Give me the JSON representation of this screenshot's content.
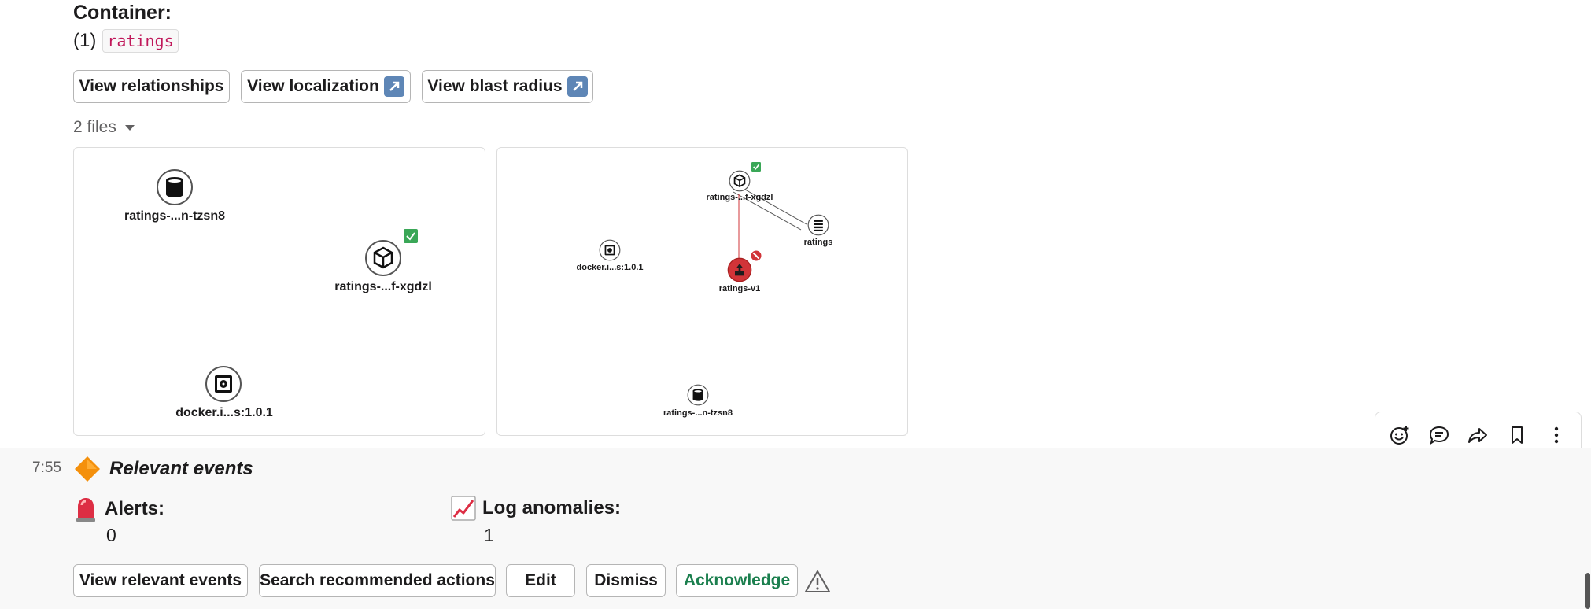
{
  "container": {
    "heading": "Container:",
    "index": "(1)",
    "name": "ratings"
  },
  "buttons": {
    "relationships": "View relationships",
    "localization": "View localization",
    "blast_radius": "View blast radius"
  },
  "files": {
    "count_label": "2 files",
    "preview1": {
      "nodes": [
        {
          "label": "ratings-...n-tzsn8",
          "icon": "database-icon"
        },
        {
          "label": "ratings-...f-xgdzl",
          "icon": "cube-icon",
          "badge": "check-badge"
        },
        {
          "label": "docker.i...s:1.0.1",
          "icon": "disk-icon"
        }
      ]
    },
    "preview2": {
      "nodes": [
        {
          "label": "ratings-...f-xgdzl",
          "icon": "cube-icon",
          "badge": "check-badge"
        },
        {
          "label": "ratings",
          "icon": "list-icon"
        },
        {
          "label": "docker.i...s:1.0.1",
          "icon": "disk-icon"
        },
        {
          "label": "ratings-v1",
          "icon": "deployment-icon",
          "badge": "error-badge"
        },
        {
          "label": "ratings-...n-tzsn8",
          "icon": "database-icon"
        }
      ]
    }
  },
  "events": {
    "time": "7:55",
    "title": "Relevant events",
    "alerts_label": "Alerts:",
    "alerts_value": "0",
    "anomalies_label": "Log anomalies:",
    "anomalies_value": "1"
  },
  "actions": {
    "view_events": "View relevant events",
    "search_actions": "Search recommended actions",
    "edit": "Edit",
    "dismiss": "Dismiss",
    "acknowledge": "Acknowledge"
  },
  "toolbar": {
    "icons": [
      "add-reaction-icon",
      "reply-thread-icon",
      "forward-icon",
      "bookmark-icon",
      "more-actions-icon"
    ]
  },
  "colors": {
    "acknowledge": "#1b7f4e",
    "error_node": "#d13438",
    "check_badge": "#3aa757",
    "code_text": "#c0185a"
  }
}
